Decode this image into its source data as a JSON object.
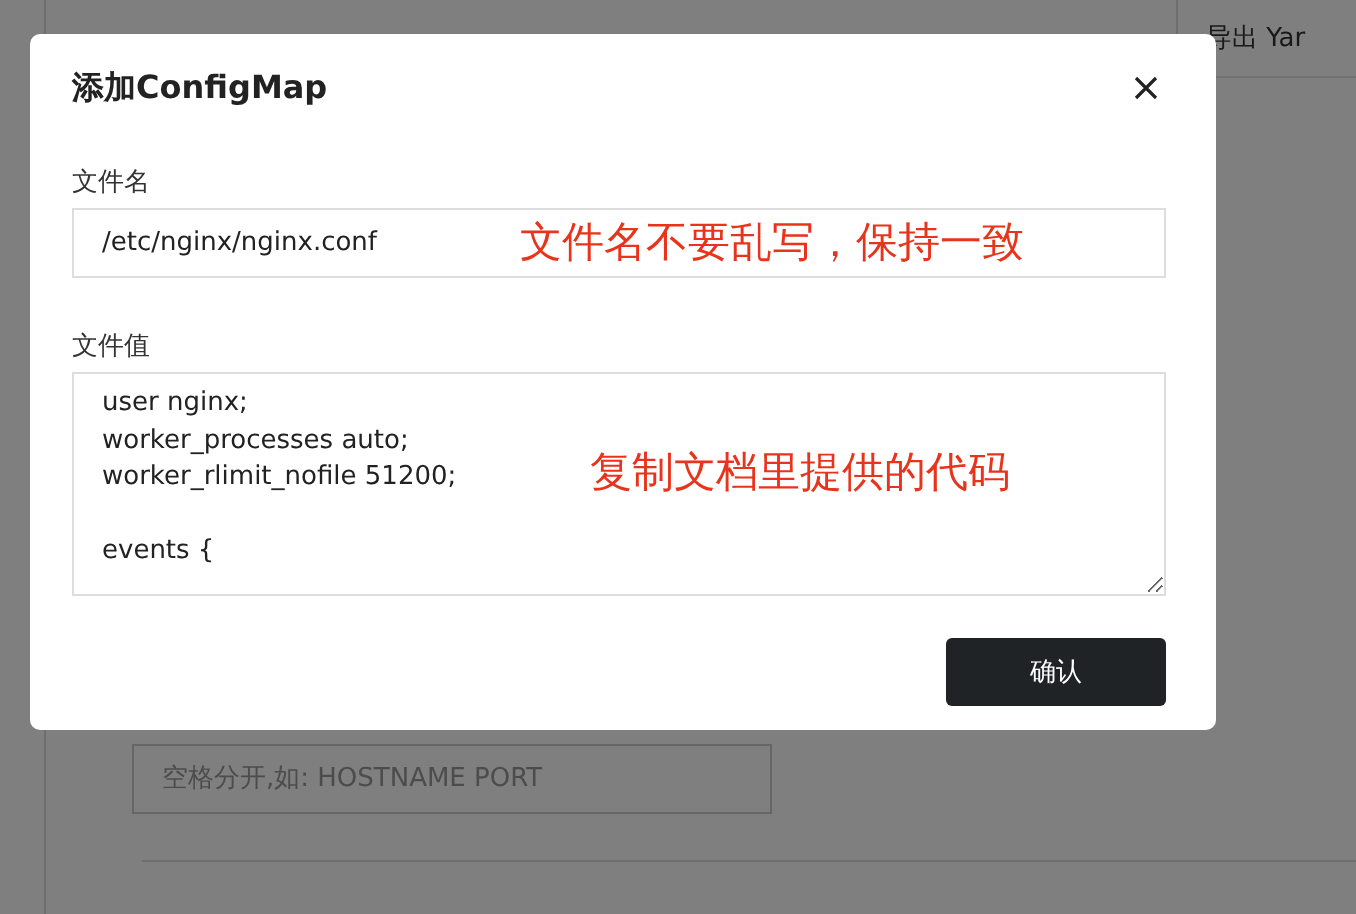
{
  "background_page": {
    "export_button": "导出 Yar",
    "args_field": {
      "placeholder": "空格分开,如: HOSTNAME PORT"
    }
  },
  "dialog": {
    "title": "添加ConfigMap",
    "file_name": {
      "label": "文件名",
      "value": "/etc/nginx/nginx.conf",
      "annotation": "文件名不要乱写，保持一致"
    },
    "file_value": {
      "label": "文件值",
      "blocks": [
        [
          "user nginx;",
          "worker_processes auto;",
          "worker_rlimit_nofile 51200;"
        ],
        [
          "events {"
        ]
      ],
      "annotation": "复制文档里提供的代码"
    },
    "confirm_button": "确认"
  }
}
